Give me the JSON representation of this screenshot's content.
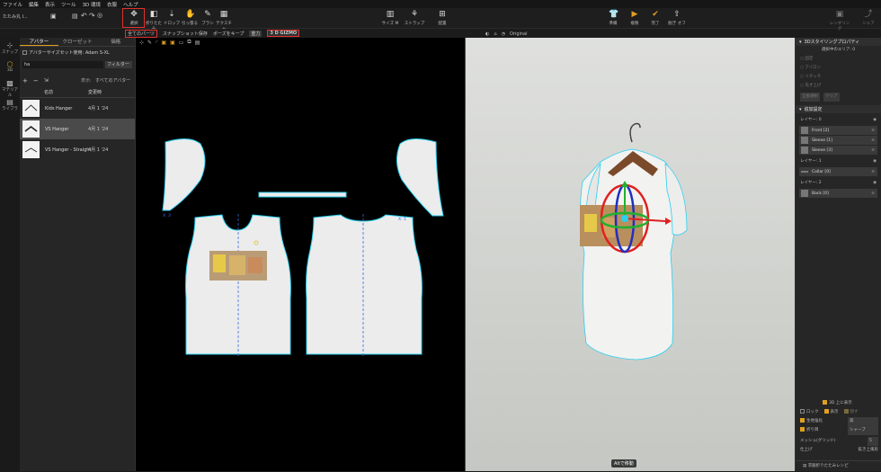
{
  "menu": [
    "ファイル",
    "編集",
    "表示",
    "ツール",
    "3D 環境",
    "衣服",
    "ヘルプ"
  ],
  "toolbar": {
    "file_title": "たたみ丸 l...",
    "select": "選択",
    "fold": "折りたたみ",
    "drop": "ドロップ",
    "pull": "引っ張る",
    "brush": "ブラシ",
    "texture": "テクスチャ",
    "size": "サイズ M",
    "strap": "ストラップ",
    "place": "配置",
    "spec": "準備",
    "play": "複製",
    "done": "完了",
    "release": "脱ぎ オフ",
    "render": "レンダリング",
    "share": "シェア"
  },
  "subbar": {
    "all_parts": "全てのパーツ",
    "snapshot": "スナップショット保存",
    "pose_save": "ポーズをキープ",
    "gravity": "重力",
    "gizmo_3d": "3 D",
    "gizmo": "GIZMO",
    "original": "Original"
  },
  "leftstrip": [
    "スナップ",
    "3D",
    "マテリアル",
    "ライブラ"
  ],
  "library": {
    "tabs": [
      "アバター",
      "クローゼット",
      "価格"
    ],
    "size_set": "アバターサイズセット使用: Adam S-XL",
    "search_value": "ha",
    "filter": "フィルター",
    "display": "表示:",
    "display_value": "すべてのアバター",
    "col_name": "名前",
    "col_date": "変更時",
    "items": [
      {
        "name": "Kids Hanger",
        "date": "4月 1 '24"
      },
      {
        "name": "VS Hanger",
        "date": "4月 1 '24"
      },
      {
        "name": "VS Hanger - Straight",
        "date": "4月 1 '24"
      }
    ]
  },
  "view2d": {
    "label_x3": "X: 3",
    "label_x1": "X: 1"
  },
  "right": {
    "section1": "3Dスタイリングプロパティ",
    "selected_area": "選択中のエリア: 0",
    "options": [
      "固定",
      "アイロン",
      "リタッチ",
      "先ず上げ"
    ],
    "all_select": "全部選択",
    "clear": "クリア",
    "section2": "追加設定",
    "layer0": "レイヤー: 0",
    "layer0_items": [
      "Front [2]",
      "Sleeve [1]",
      "Sleeve [3]"
    ],
    "layer1": "レイヤー: 1",
    "layer1_items": [
      "Collar [0]"
    ],
    "layer2": "レイヤー: 2",
    "layer2_items": [
      "Back [0]"
    ],
    "show_3d": "3D 上に表示",
    "lock": "ロック",
    "show": "表示",
    "hide": "隠す",
    "fold_strength": "生地強化",
    "fold_strength_value": "高",
    "fold_line": "折り目",
    "fold_line_value": "シャープ",
    "mesh": "メッシュ(グリッド)",
    "mesh_value": "5",
    "finish": "仕上げ",
    "finish_value": "鉱き上風形",
    "footer": "衣服折りたたみレシピ"
  },
  "hint": "Altで移動",
  "colors": {
    "accent": "#e0a020",
    "highlight": "#e03030",
    "seam": "#2ad0f0"
  }
}
